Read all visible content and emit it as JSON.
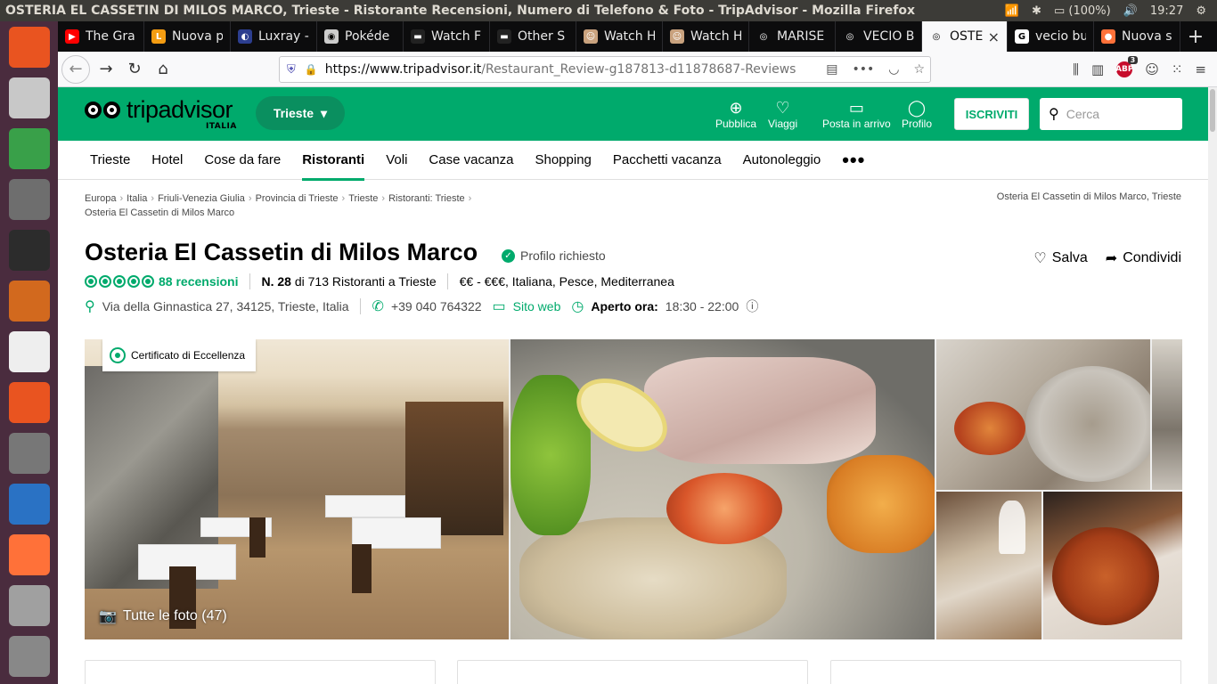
{
  "os": {
    "window_title": "OSTERIA EL CASSETIN DI MILOS MARCO, Trieste - Ristorante Recensioni, Numero di Telefono & Foto - TripAdvisor - Mozilla Firefox",
    "battery": "(100%)",
    "clock": "19:27"
  },
  "launcher": {
    "items": [
      {
        "name": "ubuntu-dash-icon",
        "color": "#e95420"
      },
      {
        "name": "sudoku-icon",
        "color": "#c8c8c8"
      },
      {
        "name": "calc-spreadsheet-icon",
        "color": "#39a049"
      },
      {
        "name": "file-manager-icon",
        "color": "#6e6e6e"
      },
      {
        "name": "terminal-icon",
        "color": "#2c2c2c"
      },
      {
        "name": "impress-icon",
        "color": "#d2691e"
      },
      {
        "name": "amazon-icon",
        "color": "#eeeeee"
      },
      {
        "name": "software-center-icon",
        "color": "#e95420"
      },
      {
        "name": "system-settings-icon",
        "color": "#777777"
      },
      {
        "name": "writer-icon",
        "color": "#2a72c4"
      },
      {
        "name": "firefox-icon",
        "color": "#ff7139"
      },
      {
        "name": "drive-icon",
        "color": "#a0a0a0"
      },
      {
        "name": "trash-icon",
        "color": "#888888"
      }
    ]
  },
  "tabs": [
    {
      "label": "The Gra",
      "icon_color": "#ff0000",
      "icon_glyph": "▶"
    },
    {
      "label": "Nuova p",
      "icon_color": "#f39c12",
      "icon_glyph": "L"
    },
    {
      "label": "Luxray -",
      "icon_color": "#2c3e8f",
      "icon_glyph": "◐"
    },
    {
      "label": "Pokéde",
      "icon_color": "#cccccc",
      "icon_glyph": "◉"
    },
    {
      "label": "Watch F",
      "icon_color": "#222222",
      "icon_glyph": "▬"
    },
    {
      "label": "Other S",
      "icon_color": "#222222",
      "icon_glyph": "▬"
    },
    {
      "label": "Watch H",
      "icon_color": "#c9a27e",
      "icon_glyph": "☺"
    },
    {
      "label": "Watch H",
      "icon_color": "#c9a27e",
      "icon_glyph": "☺"
    },
    {
      "label": "MARISE",
      "icon_color": "#0c0c0d",
      "icon_glyph": "◎"
    },
    {
      "label": "VECIO B",
      "icon_color": "#0c0c0d",
      "icon_glyph": "◎"
    },
    {
      "label": "OSTE",
      "icon_color": "#f9f9fa",
      "icon_glyph": "◎",
      "active": true
    },
    {
      "label": "vecio bu",
      "icon_color": "#ffffff",
      "icon_glyph": "G"
    },
    {
      "label": "Nuova s",
      "icon_color": "#ff7139",
      "icon_glyph": "●"
    }
  ],
  "urlbar": {
    "host": "https://www.tripadvisor.it",
    "path": "/Restaurant_Review-g187813-d11878687-Reviews"
  },
  "abp_count": "3",
  "ta": {
    "logo_word": "tripadvisor",
    "logo_sub": "ITALIA",
    "geo": "Trieste",
    "actions": [
      {
        "label": "Pubblica",
        "icon": "plus-circle-icon",
        "glyph": "⊕"
      },
      {
        "label": "Viaggi",
        "icon": "heart-icon",
        "glyph": "♡"
      },
      {
        "label": "Posta in arrivo",
        "icon": "chat-icon",
        "glyph": "▭"
      },
      {
        "label": "Profilo",
        "icon": "user-icon",
        "glyph": "◯"
      }
    ],
    "signup": "ISCRIVITI",
    "search_placeholder": "Cerca"
  },
  "categories": [
    "Trieste",
    "Hotel",
    "Cose da fare",
    "Ristoranti",
    "Voli",
    "Case vacanza",
    "Shopping",
    "Pacchetti vacanza",
    "Autonoleggio"
  ],
  "active_category": "Ristoranti",
  "breadcrumbs": [
    "Europa",
    "Italia",
    "Friuli-Venezia Giulia",
    "Provincia di Trieste",
    "Trieste",
    "Ristoranti: Trieste"
  ],
  "breadcrumb_current": "Osteria El Cassetin di Milos Marco",
  "breadcrumb_right": "Osteria El Cassetin di Milos Marco, Trieste",
  "listing": {
    "name": "Osteria El Cassetin di Milos Marco",
    "claimed": "Profilo richiesto",
    "save": "Salva",
    "share": "Condividi",
    "rating": 5,
    "reviews": "88 recensioni",
    "rank_num": "N. 28",
    "rank_text": "di 713 Ristoranti a Trieste",
    "cuisine": "€€ - €€€, Italiana, Pesce, Mediterranea",
    "address": "Via della Ginnastica 27, 34125, Trieste, Italia",
    "phone": "+39 040 764322",
    "website": "Sito web",
    "open_label": "Aperto ora:",
    "open_hours": "18:30 - 22:00"
  },
  "photos": {
    "certificate": "Certificato di Eccellenza",
    "all_photos": "Tutte le foto (47)"
  },
  "colors": {
    "brand": "#00aa6c"
  }
}
